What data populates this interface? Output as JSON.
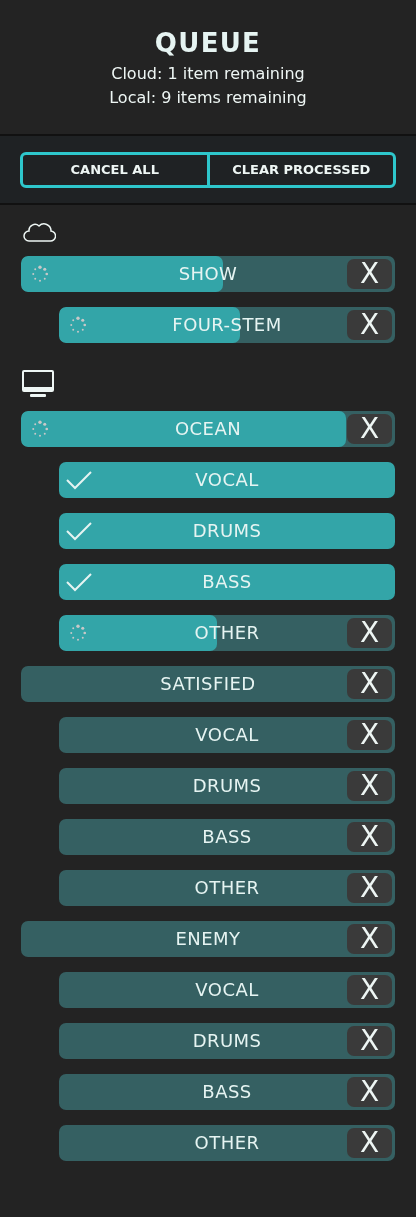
{
  "header": {
    "title": "QUEUE",
    "lines": [
      "Cloud: 1 item remaining",
      "Local: 9 items remaining"
    ]
  },
  "buttons": [
    "CANCEL ALL",
    "CLEAR PROCESSED"
  ],
  "sections": [
    {
      "kind": "cloud",
      "items": [
        {
          "label": "SHOW",
          "kind": "processing",
          "level": 0.54,
          "remove": "X",
          "children": [
            {
              "label": "FOUR-STEM",
              "kind": "processing",
              "level": 0.54,
              "remove": "X"
            }
          ]
        }
      ]
    },
    {
      "kind": "local",
      "items": [
        {
          "label": "OCEAN",
          "kind": "processing",
          "level": 0.87,
          "remove": "X",
          "children": [
            {
              "label": "VOCAL",
              "kind": "done"
            },
            {
              "label": "DRUMS",
              "kind": "done"
            },
            {
              "label": "BASS",
              "kind": "done"
            },
            {
              "label": "OTHER",
              "kind": "processing",
              "level": 0.47,
              "remove": "X"
            }
          ]
        },
        {
          "label": "SATISFIED",
          "kind": "queued",
          "remove": "X",
          "children": [
            {
              "label": "VOCAL",
              "kind": "queued",
              "remove": "X"
            },
            {
              "label": "DRUMS",
              "kind": "queued",
              "remove": "X"
            },
            {
              "label": "BASS",
              "kind": "queued",
              "remove": "X"
            },
            {
              "label": "OTHER",
              "kind": "queued",
              "remove": "X"
            }
          ]
        },
        {
          "label": "ENEMY",
          "kind": "queued",
          "remove": "X",
          "children": [
            {
              "label": "VOCAL",
              "kind": "queued",
              "remove": "X"
            },
            {
              "label": "DRUMS",
              "kind": "queued",
              "remove": "X"
            },
            {
              "label": "BASS",
              "kind": "queued",
              "remove": "X"
            },
            {
              "label": "OTHER",
              "kind": "queued",
              "remove": "X"
            }
          ]
        }
      ]
    }
  ]
}
